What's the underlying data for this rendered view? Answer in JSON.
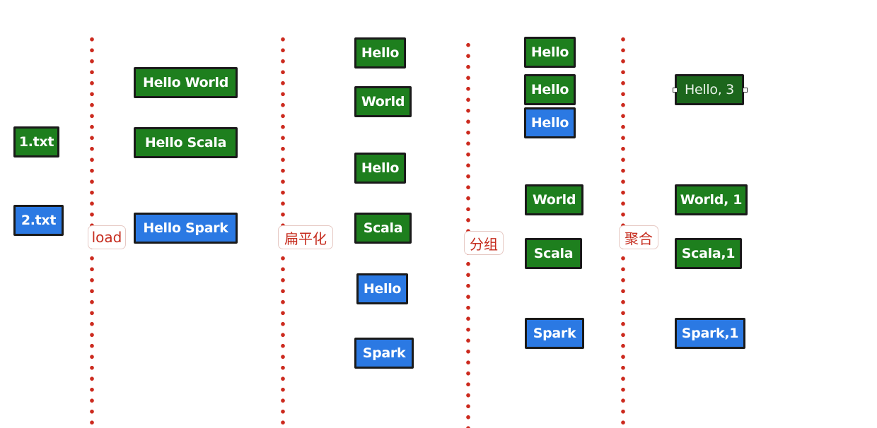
{
  "files": [
    "1.txt",
    "2.txt"
  ],
  "steps": [
    "load",
    "扁平化",
    "分组",
    "聚合"
  ],
  "lines": [
    "Hello World",
    "Hello Scala",
    "Hello Spark"
  ],
  "words": [
    "Hello",
    "World",
    "Hello",
    "Scala",
    "Hello",
    "Spark"
  ],
  "groups": [
    "Hello",
    "Hello",
    "Hello",
    "World",
    "Scala",
    "Spark"
  ],
  "counts": [
    "Hello, 3",
    "World, 1",
    "Scala,1",
    "Spark,1"
  ],
  "colors": {
    "file1": "#1e7f1e",
    "file2": "#2b79e3",
    "divider": "#cc2a1e",
    "step_text": "#c62d1f"
  }
}
